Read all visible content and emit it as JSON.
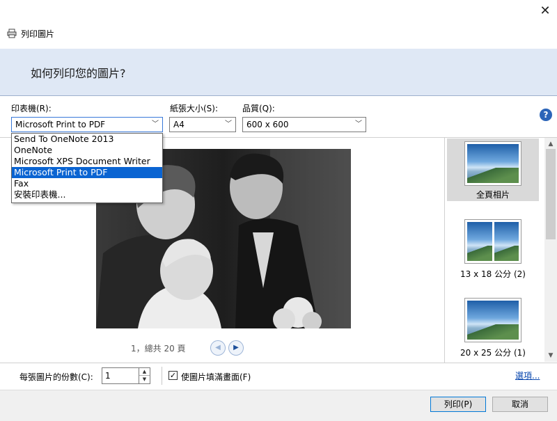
{
  "window": {
    "title": "列印圖片",
    "close_label": "✕"
  },
  "banner": {
    "heading": "如何列印您的圖片?"
  },
  "printer": {
    "label": "印表機(R):",
    "selected": "Microsoft Print to PDF",
    "options": [
      "Send To OneNote 2013",
      "OneNote",
      "Microsoft XPS Document Writer",
      "Microsoft Print to PDF",
      "Fax",
      "安裝印表機..."
    ],
    "selected_index": 3
  },
  "paper_size": {
    "label": "紙張大小(S):",
    "selected": "A4"
  },
  "quality": {
    "label": "品質(Q):",
    "selected": "600 x 600"
  },
  "help": {
    "glyph": "?"
  },
  "pager": {
    "text": "1，總共 20 頁",
    "prev_glyph": "◀",
    "next_glyph": "▶"
  },
  "layouts": [
    {
      "label": "全頁相片",
      "selected": true
    },
    {
      "label": "13 x 18 公分 (2)",
      "selected": false
    },
    {
      "label": "20 x 25 公分 (1)",
      "selected": false
    }
  ],
  "copies": {
    "label": "每張圖片的份數(C):",
    "value": "1",
    "up_glyph": "▲",
    "down_glyph": "▼"
  },
  "fit": {
    "label": "使圖片填滿畫面(F)",
    "checked": true,
    "check_glyph": "✓"
  },
  "options_link": "選項...",
  "buttons": {
    "print": "列印(P)",
    "cancel": "取消"
  },
  "scroll": {
    "up_glyph": "▲",
    "down_glyph": "▼"
  },
  "colors": {
    "banner": "#dfe8f5",
    "selection": "#0a64d2",
    "link": "#0645ad",
    "help": "#2b64b8"
  }
}
